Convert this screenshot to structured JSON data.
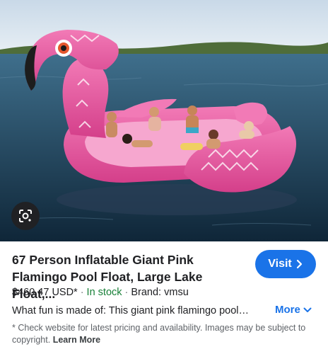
{
  "product": {
    "title": "67 Person Inflatable Giant Pink Flamingo Pool Float, Large Lake Float,...",
    "price": "$460.47 USD*",
    "separator": "·",
    "stock_status": "In stock",
    "brand": "Brand: vmsu",
    "description": "What fun is made of: This giant pink flamingo pool…",
    "more_label": "More",
    "disclaimer": "* Check website for latest pricing and availability. Images may be subject to copyright.",
    "learn_more_label": "Learn More"
  },
  "actions": {
    "visit_label": "Visit"
  },
  "icons": {
    "lens": "google-lens-icon",
    "visit_arrow": "chevron-right-icon",
    "more_arrow": "chevron-down-icon"
  },
  "colors": {
    "accent": "#1a73e8",
    "in_stock": "#188038",
    "float_pink": "#e8559c"
  }
}
